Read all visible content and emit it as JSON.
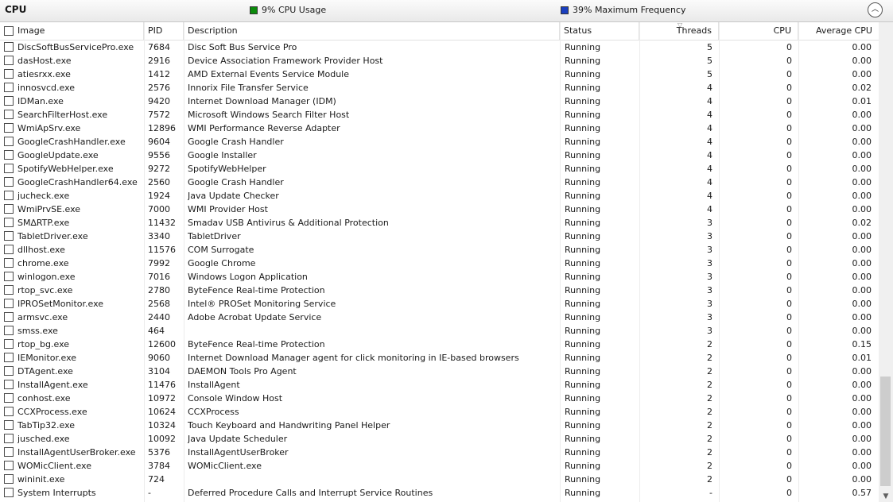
{
  "header": {
    "title": "CPU",
    "cpu_usage": "9% CPU Usage",
    "max_frequency": "39% Maximum Frequency",
    "cpu_usage_color": "#0b8a0b",
    "max_frequency_color": "#1a3fbf",
    "collapse_icon": "chevron-up-icon"
  },
  "columns": {
    "image": "Image",
    "pid": "PID",
    "description": "Description",
    "status": "Status",
    "threads": "Threads",
    "cpu": "CPU",
    "avg_cpu": "Average CPU"
  },
  "rows": [
    {
      "image": "DiscSoftBusServicePro.exe",
      "pid": "7684",
      "description": "Disc Soft Bus Service Pro",
      "status": "Running",
      "threads": "5",
      "cpu": "0",
      "avg": "0.00"
    },
    {
      "image": "dasHost.exe",
      "pid": "2916",
      "description": "Device Association Framework Provider Host",
      "status": "Running",
      "threads": "5",
      "cpu": "0",
      "avg": "0.00"
    },
    {
      "image": "atiesrxx.exe",
      "pid": "1412",
      "description": "AMD External Events Service Module",
      "status": "Running",
      "threads": "5",
      "cpu": "0",
      "avg": "0.00"
    },
    {
      "image": "innosvcd.exe",
      "pid": "2576",
      "description": "Innorix File Transfer Service",
      "status": "Running",
      "threads": "4",
      "cpu": "0",
      "avg": "0.02"
    },
    {
      "image": "IDMan.exe",
      "pid": "9420",
      "description": "Internet Download Manager (IDM)",
      "status": "Running",
      "threads": "4",
      "cpu": "0",
      "avg": "0.01"
    },
    {
      "image": "SearchFilterHost.exe",
      "pid": "7572",
      "description": "Microsoft Windows Search Filter Host",
      "status": "Running",
      "threads": "4",
      "cpu": "0",
      "avg": "0.00"
    },
    {
      "image": "WmiApSrv.exe",
      "pid": "12896",
      "description": "WMI Performance Reverse Adapter",
      "status": "Running",
      "threads": "4",
      "cpu": "0",
      "avg": "0.00"
    },
    {
      "image": "GoogleCrashHandler.exe",
      "pid": "9604",
      "description": "Google Crash Handler",
      "status": "Running",
      "threads": "4",
      "cpu": "0",
      "avg": "0.00"
    },
    {
      "image": "GoogleUpdate.exe",
      "pid": "9556",
      "description": "Google Installer",
      "status": "Running",
      "threads": "4",
      "cpu": "0",
      "avg": "0.00"
    },
    {
      "image": "SpotifyWebHelper.exe",
      "pid": "9272",
      "description": "SpotifyWebHelper",
      "status": "Running",
      "threads": "4",
      "cpu": "0",
      "avg": "0.00"
    },
    {
      "image": "GoogleCrashHandler64.exe",
      "pid": "2560",
      "description": "Google Crash Handler",
      "status": "Running",
      "threads": "4",
      "cpu": "0",
      "avg": "0.00"
    },
    {
      "image": "jucheck.exe",
      "pid": "1924",
      "description": "Java Update Checker",
      "status": "Running",
      "threads": "4",
      "cpu": "0",
      "avg": "0.00"
    },
    {
      "image": "WmiPrvSE.exe",
      "pid": "7000",
      "description": "WMI Provider Host",
      "status": "Running",
      "threads": "4",
      "cpu": "0",
      "avg": "0.00"
    },
    {
      "image": "SM∆RTP.exe",
      "pid": "11432",
      "description": "Smadav USB Antivirus & Additional Protection",
      "status": "Running",
      "threads": "3",
      "cpu": "0",
      "avg": "0.02"
    },
    {
      "image": "TabletDriver.exe",
      "pid": "3340",
      "description": "TabletDriver",
      "status": "Running",
      "threads": "3",
      "cpu": "0",
      "avg": "0.00"
    },
    {
      "image": "dllhost.exe",
      "pid": "11576",
      "description": "COM Surrogate",
      "status": "Running",
      "threads": "3",
      "cpu": "0",
      "avg": "0.00"
    },
    {
      "image": "chrome.exe",
      "pid": "7992",
      "description": "Google Chrome",
      "status": "Running",
      "threads": "3",
      "cpu": "0",
      "avg": "0.00"
    },
    {
      "image": "winlogon.exe",
      "pid": "7016",
      "description": "Windows Logon Application",
      "status": "Running",
      "threads": "3",
      "cpu": "0",
      "avg": "0.00"
    },
    {
      "image": "rtop_svc.exe",
      "pid": "2780",
      "description": "ByteFence Real-time Protection",
      "status": "Running",
      "threads": "3",
      "cpu": "0",
      "avg": "0.00"
    },
    {
      "image": "IPROSetMonitor.exe",
      "pid": "2568",
      "description": "Intel® PROSet Monitoring Service",
      "status": "Running",
      "threads": "3",
      "cpu": "0",
      "avg": "0.00"
    },
    {
      "image": "armsvc.exe",
      "pid": "2440",
      "description": "Adobe Acrobat Update Service",
      "status": "Running",
      "threads": "3",
      "cpu": "0",
      "avg": "0.00"
    },
    {
      "image": "smss.exe",
      "pid": "464",
      "description": "",
      "status": "Running",
      "threads": "3",
      "cpu": "0",
      "avg": "0.00"
    },
    {
      "image": "rtop_bg.exe",
      "pid": "12600",
      "description": "ByteFence Real-time Protection",
      "status": "Running",
      "threads": "2",
      "cpu": "0",
      "avg": "0.15"
    },
    {
      "image": "IEMonitor.exe",
      "pid": "9060",
      "description": "Internet Download Manager agent for click monitoring in IE-based browsers",
      "status": "Running",
      "threads": "2",
      "cpu": "0",
      "avg": "0.01"
    },
    {
      "image": "DTAgent.exe",
      "pid": "3104",
      "description": "DAEMON Tools Pro Agent",
      "status": "Running",
      "threads": "2",
      "cpu": "0",
      "avg": "0.00"
    },
    {
      "image": "InstallAgent.exe",
      "pid": "11476",
      "description": "InstallAgent",
      "status": "Running",
      "threads": "2",
      "cpu": "0",
      "avg": "0.00"
    },
    {
      "image": "conhost.exe",
      "pid": "10972",
      "description": "Console Window Host",
      "status": "Running",
      "threads": "2",
      "cpu": "0",
      "avg": "0.00"
    },
    {
      "image": "CCXProcess.exe",
      "pid": "10624",
      "description": "CCXProcess",
      "status": "Running",
      "threads": "2",
      "cpu": "0",
      "avg": "0.00"
    },
    {
      "image": "TabTip32.exe",
      "pid": "10324",
      "description": "Touch Keyboard and Handwriting Panel Helper",
      "status": "Running",
      "threads": "2",
      "cpu": "0",
      "avg": "0.00"
    },
    {
      "image": "jusched.exe",
      "pid": "10092",
      "description": "Java Update Scheduler",
      "status": "Running",
      "threads": "2",
      "cpu": "0",
      "avg": "0.00"
    },
    {
      "image": "InstallAgentUserBroker.exe",
      "pid": "5376",
      "description": "InstallAgentUserBroker",
      "status": "Running",
      "threads": "2",
      "cpu": "0",
      "avg": "0.00"
    },
    {
      "image": "WOMicClient.exe",
      "pid": "3784",
      "description": "WOMicClient.exe",
      "status": "Running",
      "threads": "2",
      "cpu": "0",
      "avg": "0.00"
    },
    {
      "image": "wininit.exe",
      "pid": "724",
      "description": "",
      "status": "Running",
      "threads": "2",
      "cpu": "0",
      "avg": "0.00"
    },
    {
      "image": "System Interrupts",
      "pid": "-",
      "description": "Deferred Procedure Calls and Interrupt Service Routines",
      "status": "Running",
      "threads": "-",
      "cpu": "0",
      "avg": "0.57"
    }
  ]
}
